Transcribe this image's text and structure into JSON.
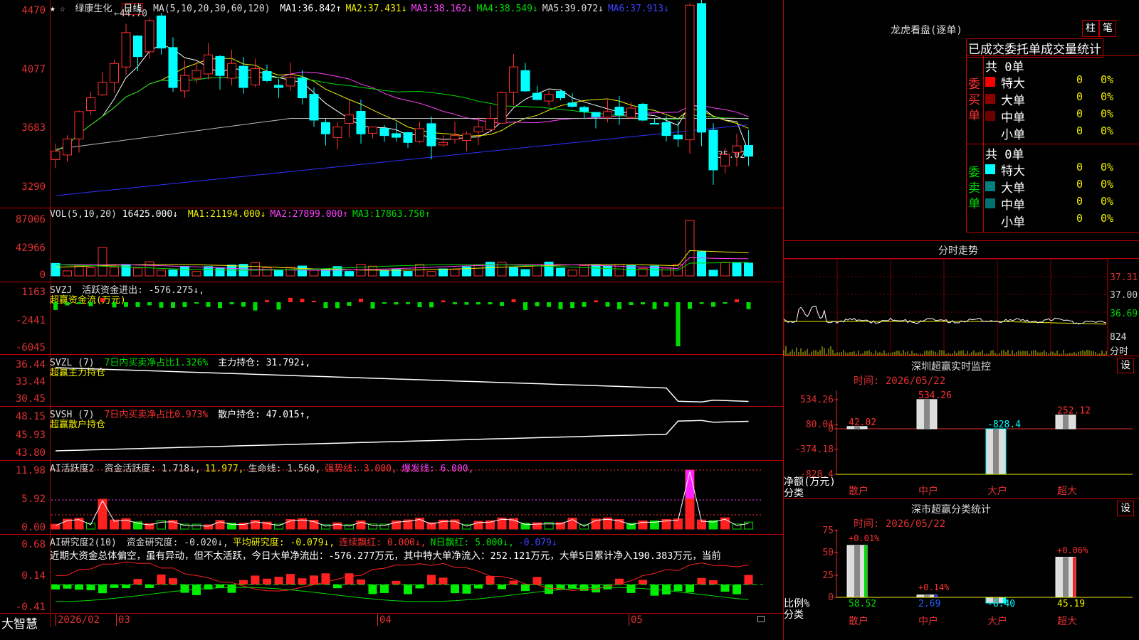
{
  "stock": {
    "name": "绿康生化",
    "period": "日线",
    "ma_header": "MA(5,10,20,30,60,120)",
    "ma": [
      {
        "label": "MA1:",
        "value": "36.842↑",
        "color": "#ffffff"
      },
      {
        "label": "MA2:",
        "value": "37.431↓",
        "color": "#f0f000"
      },
      {
        "label": "MA3:",
        "value": "38.162↓",
        "color": "#ff40ff"
      },
      {
        "label": "MA4:",
        "value": "38.549↓",
        "color": "#00dd00"
      },
      {
        "label": "MA5:",
        "value": "39.072↓",
        "color": "#dddddd"
      },
      {
        "label": "MA6:",
        "value": "37.913↓",
        "color": "#4040ff"
      }
    ],
    "high_mark": "44.70",
    "low_mark": "←35.02",
    "y_labels": [
      "4470",
      "4077",
      "3683",
      "3290"
    ]
  },
  "vol": {
    "header": "VOL(5,10,20)",
    "value": "16425.000↓",
    "ma": [
      {
        "label": "MA1:",
        "value": "21194.000↓",
        "color": "#f0f000"
      },
      {
        "label": "MA2:",
        "value": "27899.000↑",
        "color": "#ff40ff"
      },
      {
        "label": "MA3:",
        "value": "17863.750↑",
        "color": "#00dd00"
      }
    ],
    "y_labels": [
      "87006",
      "42966",
      "0"
    ]
  },
  "svzj": {
    "header": "SVZJ",
    "label": "活跃资金进出:",
    "value": "-576.275↓,",
    "sub": "超赢资金流(万元)",
    "y_labels": [
      "1163",
      "-2441",
      "-6045"
    ]
  },
  "svzl": {
    "header": "SVZL (7)",
    "label1": "7日内买卖净占比1.326%",
    "label2": "主力持仓:",
    "value2": "31.792↓,",
    "sub": "超赢主力持仓",
    "y_labels": [
      "36.44",
      "33.44",
      "30.45"
    ]
  },
  "svsh": {
    "header": "SVSH (7)",
    "label1": "7日内买卖净占比0.973%",
    "label2": "散户持仓:",
    "value2": "47.015↑,",
    "sub": "超赢散户持仓",
    "y_labels": [
      "48.15",
      "45.93",
      "43.80"
    ]
  },
  "ai1": {
    "header": "AI活跃度2",
    "items": [
      {
        "text": "资金活跃度: 1.718↓,",
        "color": "#dddddd"
      },
      {
        "text": "11.977,",
        "color": "#f0f000"
      },
      {
        "text": "生命线: 1.560,",
        "color": "#dddddd"
      },
      {
        "text": "强势线: 3.000,",
        "color": "#ff3030"
      },
      {
        "text": "爆发线: 6.000,",
        "color": "#ff40ff"
      }
    ],
    "y_labels": [
      "11.98",
      "5.92",
      "0.00"
    ]
  },
  "ai2": {
    "header": "AI研究度2(10)",
    "items": [
      {
        "text": "资金研究度: -0.020↓,",
        "color": "#dddddd"
      },
      {
        "text": "平均研究度: -0.079↓,",
        "color": "#f0f000"
      },
      {
        "text": "连续飘红: 0.000↓,",
        "color": "#ff3030"
      },
      {
        "text": "N日飘红: 5.000↓,",
        "color": "#00dd00"
      },
      {
        "text": "-0.079↓",
        "color": "#4040ff"
      }
    ],
    "comment": "近期大资金总体偏空，虽有异动，但不太活跃，今日大单净流出：-576.277万元，其中特大单净流入：252.121万元，大单5日累计净入190.383万元，当前",
    "y_labels": [
      "0.68",
      "0.14",
      "-0.41"
    ]
  },
  "xaxis": {
    "brand": "大智慧",
    "labels": [
      "2026/02",
      "03",
      "04",
      "05"
    ]
  },
  "longhu": {
    "title": "龙虎看盘(逐单)",
    "btn_zhu": "柱",
    "btn_bi": "笔",
    "subtitle": "已成交委托单成交量统计",
    "buy_side": "委买单",
    "sell_side": "委卖单",
    "buy_total": "共 0单",
    "sell_total": "共 0单",
    "buy_rows": [
      {
        "label": "特大",
        "count": "0",
        "pct": "0%",
        "color": "#ff0000"
      },
      {
        "label": "大单",
        "count": "0",
        "pct": "0%",
        "color": "#8b0000"
      },
      {
        "label": "中单",
        "count": "0",
        "pct": "0%",
        "color": "#6b0000"
      },
      {
        "label": "小单",
        "count": "0",
        "pct": "0%",
        "color": ""
      }
    ],
    "sell_rows": [
      {
        "label": "特大",
        "count": "0",
        "pct": "0%",
        "color": "#00ffff"
      },
      {
        "label": "大单",
        "count": "0",
        "pct": "0%",
        "color": "#008080"
      },
      {
        "label": "中单",
        "count": "0",
        "pct": "0%",
        "color": "#007070"
      },
      {
        "label": "小单",
        "count": "0",
        "pct": "0%",
        "color": ""
      }
    ]
  },
  "intraday": {
    "title": "分时走势",
    "labels": [
      "37.31",
      "37.00",
      "36.69",
      "824",
      "分时"
    ]
  },
  "sz_monitor": {
    "title": "深圳超赢实时监控",
    "btn": "设",
    "time": "时间: 2026/05/22",
    "y_labels": [
      "534.26",
      "80.04",
      "0",
      "-374.18",
      "-828.4"
    ],
    "unit": "净额(万元)",
    "cat_label": "分类",
    "cats": [
      "散户",
      "中户",
      "大户",
      "超大"
    ],
    "values": [
      42.02,
      534.26,
      -828.4,
      252.12
    ],
    "value_labels": [
      "42.02",
      "534.26",
      "-828.4",
      "252.12"
    ]
  },
  "sz_class": {
    "title": "深市超赢分类统计",
    "btn": "设",
    "time": "时间: 2026/05/22",
    "y_labels": [
      "75",
      "50",
      "25",
      "0"
    ],
    "unit": "比例%",
    "cat_label": "分类",
    "cats": [
      "散户",
      "中户",
      "大户",
      "超大"
    ],
    "top_labels": [
      "+0.01%",
      "+0.14%",
      "",
      "+0.06%"
    ],
    "values": [
      58.52,
      2.69,
      -6.4,
      45.19
    ],
    "value_labels": [
      "58.52",
      "2.69",
      "-6.40",
      "45.19"
    ]
  }
}
